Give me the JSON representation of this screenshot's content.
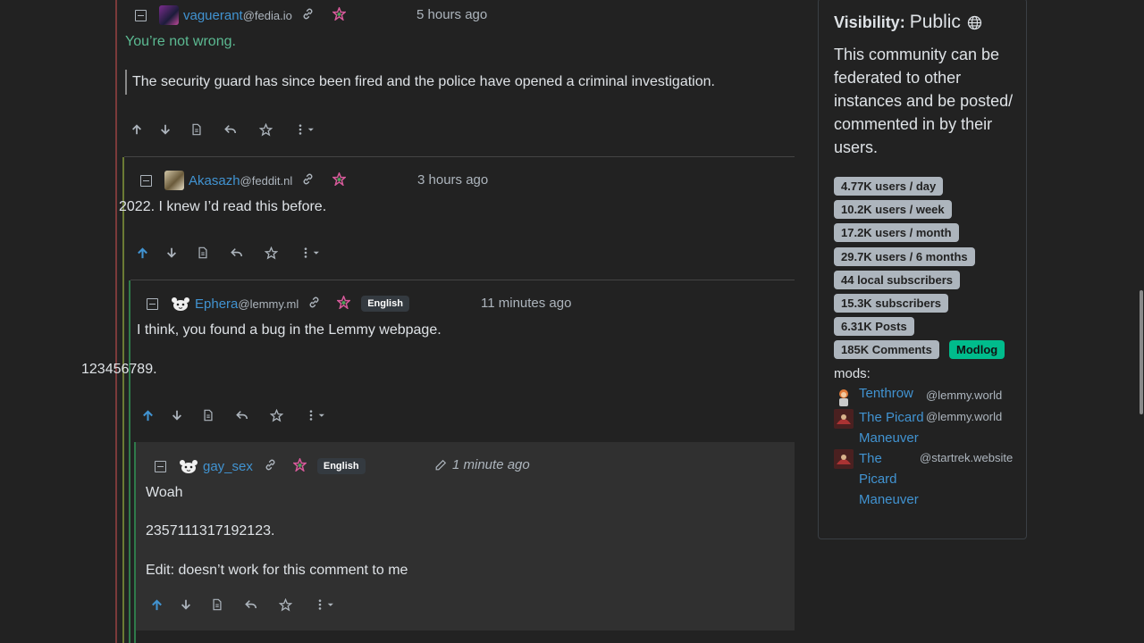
{
  "comments": [
    {
      "user": "vaguerant",
      "instance": "@fedia.io",
      "time": "5 hours ago",
      "body": "You’re not wrong.",
      "quote": "The security guard has since been fired and the police have opened a criminal investigation."
    },
    {
      "user": "Akasazh",
      "instance": "@feddit.nl",
      "time": "3 hours ago",
      "body": "2022. I knew I’d read this before."
    },
    {
      "user": "Ephera",
      "instance": "@lemmy.ml",
      "language": "English",
      "time": "11 minutes ago",
      "body": "I think, you found a bug in the Lemmy webpage.",
      "body2": "123456789."
    },
    {
      "user": "gay_sex",
      "language": "English",
      "time": "1 minute ago",
      "body": "Woah",
      "body2": "2357111317192123.",
      "body3": "Edit: doesn’t work for this comment to me"
    }
  ],
  "sidebar": {
    "visibility_label": "Visibility:",
    "visibility_value": "Public",
    "description": [
      "This community can be",
      "federated to other",
      "instances and be posted/",
      "commented in by their",
      "users."
    ],
    "stats": [
      "4.77K users / day",
      "10.2K users / week",
      "17.2K users / month",
      "29.7K users / 6 months",
      "44 local subscribers",
      "15.3K subscribers",
      "6.31K Posts",
      "185K Comments"
    ],
    "modlog": "Modlog",
    "mods_label": "mods:",
    "mods": [
      {
        "name": "Tenthrow",
        "instance": "@lemmy.world"
      },
      {
        "name_line1": "The Picard",
        "name_line2": "Maneuver",
        "instance": "@lemmy.world"
      },
      {
        "name_line1": "The",
        "name_line2": "Picard",
        "name_line3": "Maneuver",
        "instance": "@startrek.website"
      }
    ]
  },
  "colors": {
    "background": "#222222",
    "link": "#4193d1",
    "upvote_active": "#4193d1",
    "quote_green": "#5cba92",
    "modlog": "#00bc8c"
  }
}
